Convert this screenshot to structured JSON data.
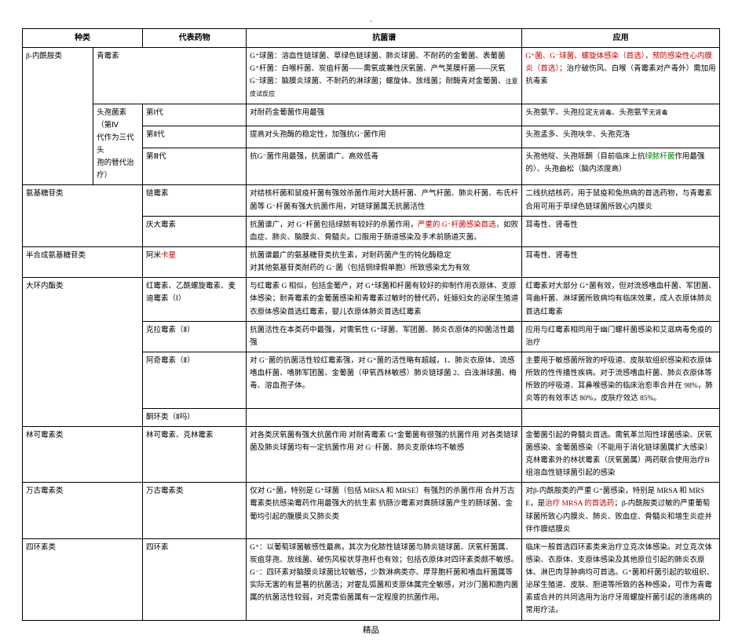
{
  "top_dot": "·",
  "footer": "精品",
  "headers": {
    "h1": "种类",
    "h2": "代表药物",
    "h3": "抗菌谱",
    "h4": "应用"
  },
  "rows": {
    "r1": {
      "cat": "β-内酰胺类",
      "drug": "青霉素",
      "spec_a": "G⁺球菌：",
      "spec_a2": "溶血性链球菌、草绿色链球菌、肺炎球菌、不耐药的金葡菌、表葡菌",
      "spec_b": "G⁺杆菌：",
      "spec_b2": "白喉杆菌、炭疽杆菌——需氧或兼性厌氧菌、产气荚膜杆菌——厌氧",
      "spec_c": "G⁻球菌：",
      "spec_c2": "脑膜炎球菌、不耐药的淋球菌；螺旋体、放线菌；耐酶青对金葡菌、",
      "spec_c3": "注意皮试反应",
      "app_a": "G⁺菌、G⁻球菌、螺旋体感染（首选），预防感染性心内膜炎（首选）；",
      "app_b": "治疗破伤风、白喉（青霉素对产毒外）需加用抗毒素"
    },
    "r2": {
      "cat1": "头孢菌素（第Ⅳ",
      "cat2": "代作为三代头",
      "cat3": "孢的替代治疗）",
      "g1": "第Ⅰ代",
      "g1_spec": "对耐药金葡菌作用最强",
      "g1_app": "头孢氨苄、头孢拉定",
      "g1_app_small": "无肾毒",
      "g1_app_tail": "、头孢氨苄",
      "g1_app_tail2": "无肾毒",
      "g2": "第Ⅱ代",
      "g2_spec": "提高对头孢酶的稳定性，加强抗G⁻菌作用",
      "g2_app": "头孢孟多、头孢呋辛、头孢克洛",
      "g3": "第Ⅲ代",
      "g3_spec": "抗G⁻菌作用最强，抗菌谱广、高效低毒",
      "g3_app_a": "头孢他啶、头孢哌酮（目前临床上抗",
      "g3_app_green": "绿脓杆菌",
      "g3_app_b": "作用最强的）、头孢曲松（脑内浓度高）"
    },
    "r3": {
      "cat": "氨基糖苷类",
      "d1": "链霉素",
      "d1_spec": "对结核杆菌和鼠疫杆菌有强效杀菌作用对大肠杆菌、产气杆菌、肺炎杆菌、布氏杆菌等 G⁻杆菌有强大抗菌作用，对链球菌属无抗菌活性",
      "d1_app": "二线抗结核药，用于鼠疫和兔热病的首选药物，与青霉素合用可用于草绿色链球菌所致心内膜炎",
      "d2": "庆大霉素",
      "d2_spec_a": "抗菌谱广，对 G⁻杆菌包括绿脓有较好的杀菌作用，",
      "d2_spec_red": "严重的 G⁻杆菌感染首选，",
      "d2_spec_b": "如败血症、肺炎、脑膜炎、骨髓炎。口服用于肠道感染及手术前肠道灭菌。",
      "d2_app": "耳毒性、肾毒性"
    },
    "r4": {
      "cat": "半合成氨基糖苷类",
      "drug_a": "阿米",
      "drug_red": "卡星",
      "spec_a": "抗菌谱最广的氨基糖苷类抗生素，对耐药菌产生的钝化酶稳定",
      "spec_b": "对其他氨基苷类耐药的 G⁻菌（包括铜绿假单胞）所致感染尤为有效",
      "app": "耳毒性、肾毒性"
    },
    "r5": {
      "cat": "大环内酯类",
      "d1": "红霉素、乙酰螺旋霉素、麦迪霉素（Ⅰ）",
      "d1_spec": "与红霉素 G 相似，包括金葡产，对 G⁺球菌和杆菌有较好的抑制作用衣原体、支原体感染；耐青霉素的金葡菌感染和青霉素过敏时的替代药，妊娠妇女的泌尿生殖道衣原体感染首选红霉素，婴儿衣原体肺炎首选红霉素",
      "d1_app": "红霉素对大部分 G⁺菌有效，但对流感嗜血杆菌、军团菌、弯曲杆菌、淋球菌所致病均有临床效果，成人衣原体肺炎首选红霉素",
      "d2": "克拉霉素（Ⅱ）",
      "d2_spec": "抗菌活性在本类药中最强，对需氧性 G⁺球菌、军团菌、肺炎衣原体的抑菌活性最强",
      "d2_app": "应用与红霉素相同用于幽门螺杆菌感染和艾滋病毒免疫的治疗",
      "d3": "阿奇霉素（Ⅱ）",
      "d3_spec": "对 G⁻菌的抗菌活性较红霉素强，对 G⁺菌的活性略有超越，1、肺炎衣原体、流感嗜血杆菌、嗜肺军团菌、金葡菌（甲氧西林敏感）肺炎链球菌 2、白浊淋球菌、梅毒、溶血孢子体。",
      "d3_app": "主要用于敏感菌所致的呼吸道、皮肤软组织感染和衣原体所致的性传播性疾病。对于流感嗜血杆菌、肺炎衣原体等所致的呼吸道、耳鼻喉感染的临床治愈率合并在 98%，肺炎等的有效率达 80%，皮肤疗效达 85%。",
      "d4": "酮环类（Ⅱ吗）"
    },
    "r6": {
      "cat": "林可霉素类",
      "drug": "林可霉素、克林霉素",
      "spec": "对各类厌氧菌有强大抗菌作用 对耐青霉素 G⁺金葡菌有很强的抗菌作用 对各类链球菌及肺炎球菌均有一定抗菌作用 对 G⁻杆菌、肺炎支原体均不敏感",
      "app": "金葡菌引起的骨髓炎首选。需氧革兰阳性球菌感染、厌氧菌感染、金葡菌感染（不能用于消化链球菌属扩大感染）克林霉素外的林状霉素（厌氧菌属）两药联合使用治疗B组溶血性链球菌引起的感染"
    },
    "r7": {
      "cat": "万古霉素类",
      "drug": "万古霉素类",
      "spec": "仅对 G⁺菌，特别是 G⁺球菌（包括 MRSA 和 MRSE）有强烈的杀菌作用 合并万古霉素类抗感染霉药作用最强大的抗生素 抗肠沙霉素对粪肠球菌产生的肠球菌、金葡均引起的腹膜炎又肺炎类",
      "app_a": "对β-内酰胺类的严重 G⁺菌感染，特别是 MRSA 和 MRSE，是",
      "app_red": "治疗 MRSA 的首选药",
      "app_b": "；β-内酰胺类过敏的严重葡萄球菌所致心内膜炎、肺炎、败血症、骨髓炎和增生炎症并伴作膜结膜炎"
    },
    "r8": {
      "cat": "四环素类",
      "drug": "四环素",
      "spec": "G⁺：以葡萄球菌敏感性最高，其次为化脓性链球菌与肺炎链球菌、厌氧杆菌属、炭疽芽孢、放线菌、破伤风梭状芽孢杆也有效；包括衣原体对四环素类颇不敏感。G⁻：四环素对脑膜炎球菌比较敏感，少数淋病类亦、厚芽胞杆菌和嗜血杆菌属等实际无害的有显著的抗菌活；对霍乱弧菌和支原体属完全敏感，对沙门菌和胞内菌属的抗菌活性较弱，对克雷伯菌属有一定程度的抗菌作用。",
      "app": "临床一般首选四环素类来治疗立克次体感染。对立克次体感染、衣原体、支原体感染及其他原位引起的肺炎衣原体、淋巴肉芽肿病均可首选。G⁺菌和杆菌引起的软组织、泌尿生殖道、皮肤、胆道等所致的各种感染，可作为青霉素或合并的共同选用为治疗牙周螺旋杆菌引起的溃疡病的常用疗法。"
    }
  }
}
